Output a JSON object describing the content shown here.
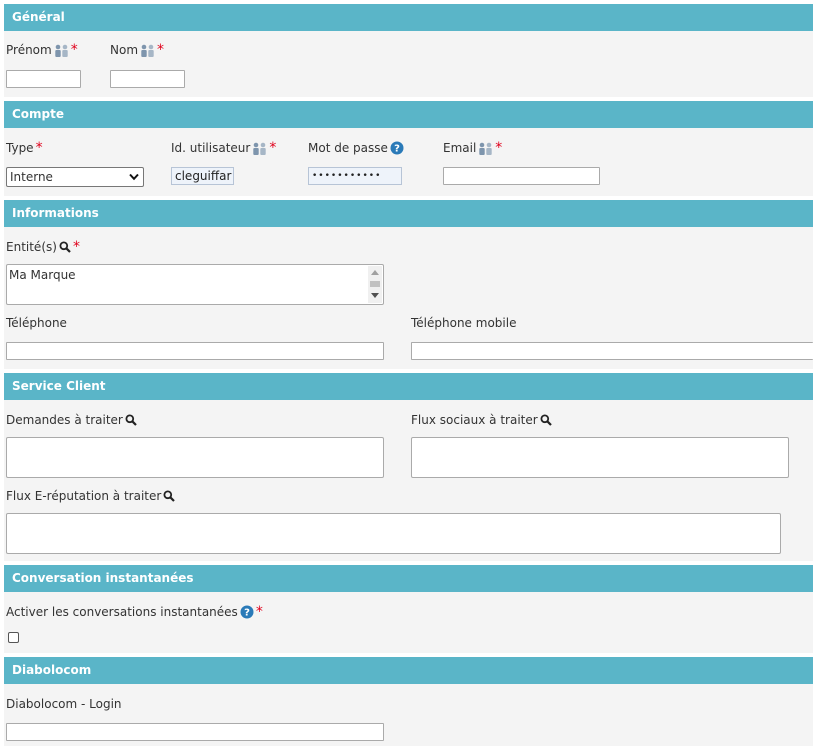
{
  "sections": {
    "general": {
      "title": "Général"
    },
    "compte": {
      "title": "Compte"
    },
    "informations": {
      "title": "Informations"
    },
    "service_client": {
      "title": "Service Client"
    },
    "conversation": {
      "title": "Conversation instantanées"
    },
    "diabolocom": {
      "title": "Diabolocom"
    }
  },
  "general": {
    "prenom_label": "Prénom",
    "nom_label": "Nom",
    "prenom_value": "",
    "nom_value": ""
  },
  "compte": {
    "type_label": "Type",
    "type_value": "Interne",
    "user_id_label": "Id. utilisateur",
    "user_id_value": "cleguiffar",
    "password_label": "Mot de passe",
    "password_value": "•••••••••••",
    "email_label": "Email",
    "email_value": ""
  },
  "informations": {
    "entites_label": "Entité(s)",
    "entites_value": "Ma Marque",
    "telephone_label": "Téléphone",
    "telephone_mobile_label": "Téléphone mobile"
  },
  "service_client": {
    "demandes_label": "Demandes à traiter",
    "flux_sociaux_label": "Flux sociaux à traiter",
    "flux_ereputation_label": "Flux E-réputation à traiter"
  },
  "conversation": {
    "activer_label": "Activer les conversations instantanées",
    "activer_checked": false
  },
  "diabolocom": {
    "login_label": "Diabolocom - Login"
  },
  "colors": {
    "header_bg": "#5ab5c8",
    "section_bg": "#f4f4f4",
    "required": "#e0001b",
    "help_icon": "#2a7ab8"
  },
  "icons": {
    "people": "people-icon",
    "help": "help-icon",
    "search": "search-icon",
    "required": "asterisk-icon"
  }
}
